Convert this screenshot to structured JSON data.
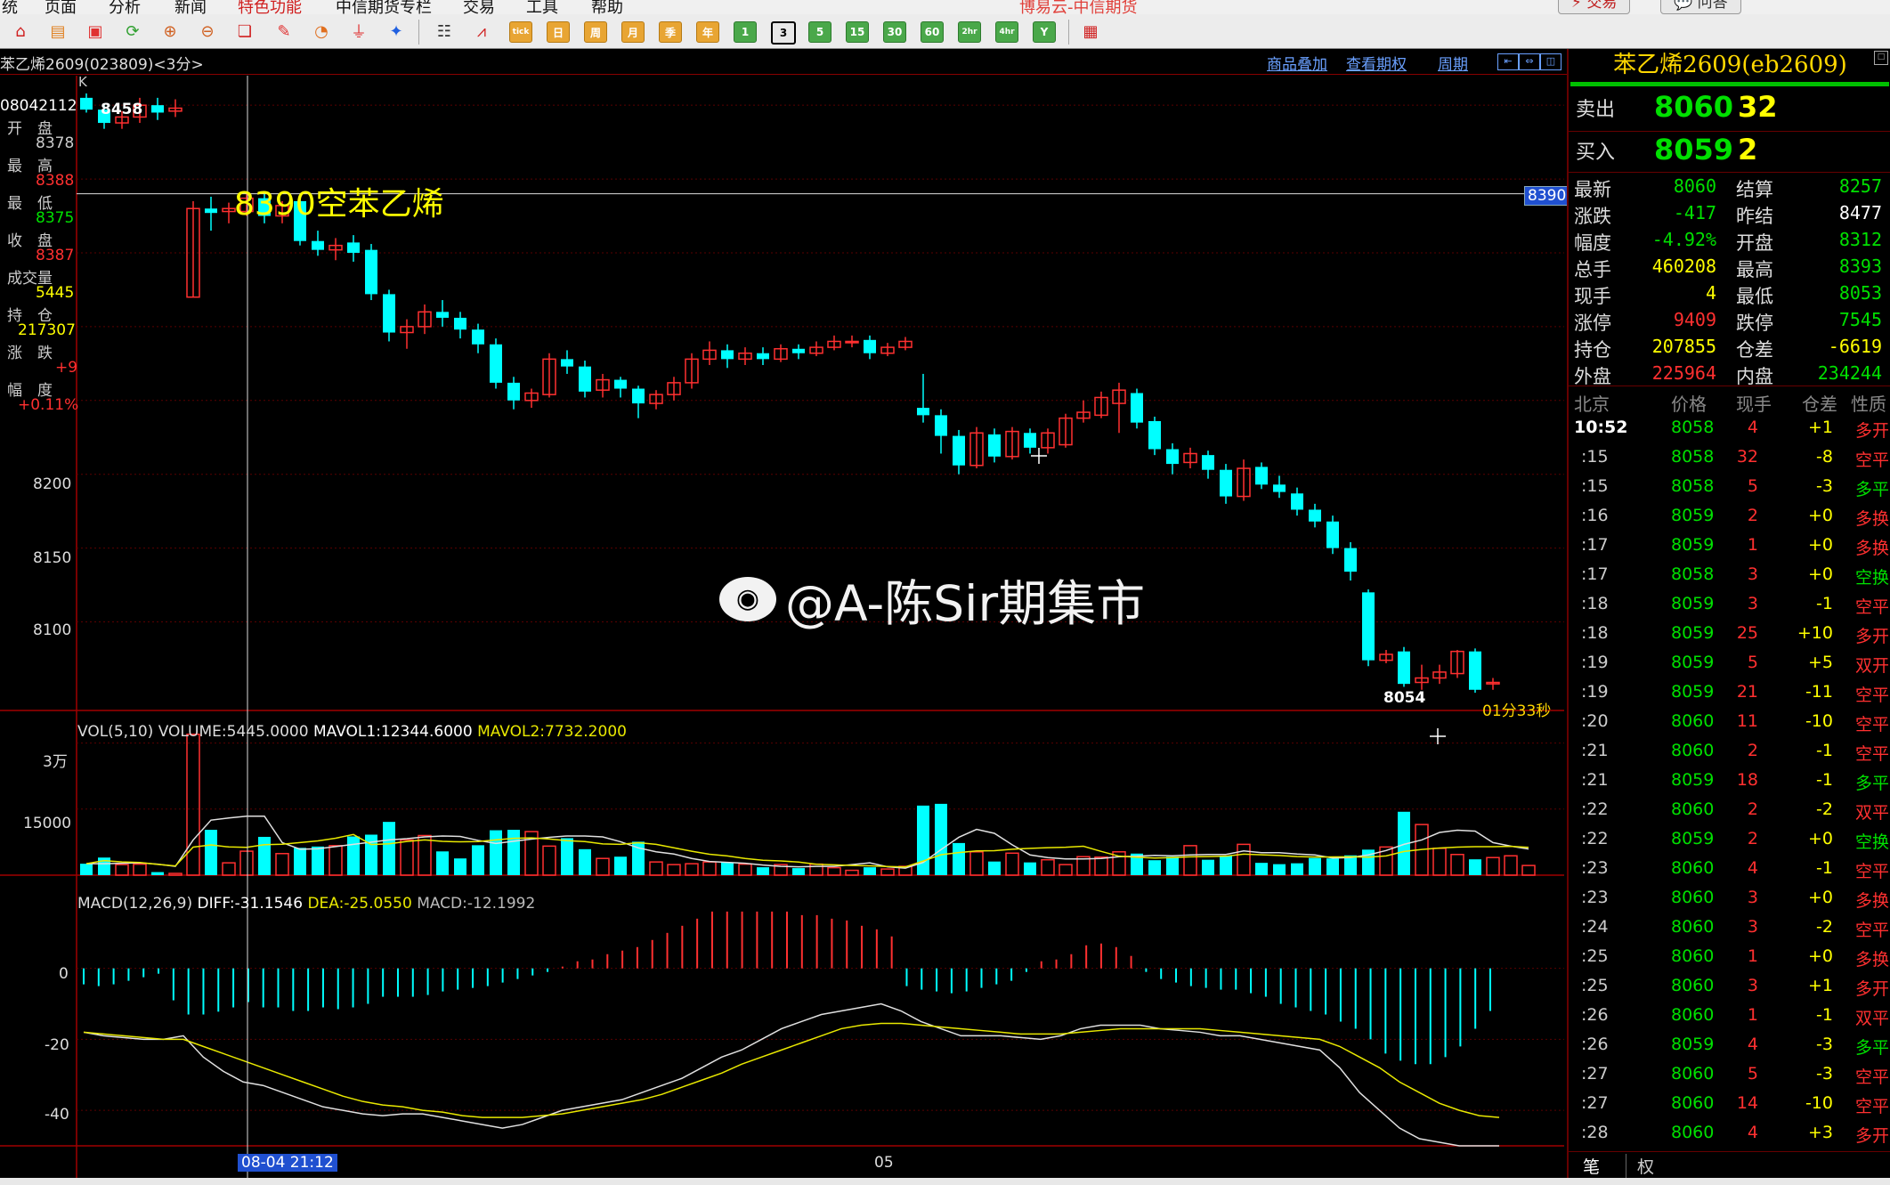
{
  "menu": {
    "items": [
      "统",
      "页面",
      "分析",
      "新闻",
      "特色功能",
      "中信期货专栏",
      "交易",
      "工具",
      "帮助"
    ],
    "window_title": "博易云-中信期货",
    "trade_button": "交易",
    "ask_button": "问答"
  },
  "toolbar": {
    "period_buttons": [
      "日",
      "周",
      "月",
      "季",
      "年"
    ],
    "minute_buttons": [
      "1",
      "3",
      "5",
      "15",
      "30",
      "60",
      "2hr",
      "4hr",
      "Y"
    ],
    "selected_period": "3"
  },
  "chart_header": {
    "symbol": "苯乙烯2609(023809)<3分>",
    "link_overlay": "商品叠加",
    "link_options": "查看期权",
    "link_period": "周期"
  },
  "info_panel": {
    "type_label": "K",
    "time": "08042112",
    "open_label": "开　盘",
    "open_value": "8378",
    "high_label": "最　高",
    "high_value": "8388",
    "low_label": "最　低",
    "low_value": "8375",
    "close_label": "收　盘",
    "close_value": "8387",
    "volume_label": "成交量",
    "volume_value": "5445",
    "oi_label": "持　仓",
    "oi_value": "217307",
    "change_label": "涨　跌",
    "change_value": "+9",
    "range_label": "幅　度",
    "range_value": "+0.11%"
  },
  "chart_data": {
    "type": "candlestick",
    "title": "苯乙烯2609(023809)<3分>",
    "ylim": [
      8040,
      8470
    ],
    "y_ticks": [
      8200,
      8150,
      8100
    ],
    "y_tick_labels": [
      "8200",
      "8150",
      "8100"
    ],
    "annotations": {
      "top_price": "8458",
      "crosshair_price": "8390",
      "crosshair_note": "8390空苯乙烯",
      "low_price": "8054",
      "countdown": "01分33秒",
      "cursor_time": "08-04 21:12",
      "date_marker": "05"
    },
    "candles": [
      [
        8455,
        8447,
        8458,
        8445
      ],
      [
        8447,
        8438,
        8450,
        8434
      ],
      [
        8438,
        8442,
        8446,
        8434
      ],
      [
        8442,
        8450,
        8455,
        8438
      ],
      [
        8450,
        8445,
        8455,
        8440
      ],
      [
        8446,
        8448,
        8454,
        8442
      ],
      [
        8320,
        8380,
        8385,
        8320
      ],
      [
        8380,
        8377,
        8388,
        8365
      ],
      [
        8378,
        8380,
        8384,
        8370
      ],
      [
        8378,
        8387,
        8390,
        8375
      ],
      [
        8387,
        8375,
        8390,
        8370
      ],
      [
        8375,
        8382,
        8385,
        8370
      ],
      [
        8385,
        8358,
        8388,
        8355
      ],
      [
        8358,
        8352,
        8365,
        8348
      ],
      [
        8352,
        8355,
        8360,
        8345
      ],
      [
        8357,
        8350,
        8362,
        8344
      ],
      [
        8352,
        8322,
        8356,
        8318
      ],
      [
        8322,
        8296,
        8325,
        8290
      ],
      [
        8296,
        8300,
        8305,
        8285
      ],
      [
        8300,
        8310,
        8315,
        8295
      ],
      [
        8310,
        8306,
        8318,
        8300
      ],
      [
        8306,
        8298,
        8310,
        8292
      ],
      [
        8298,
        8288,
        8302,
        8282
      ],
      [
        8288,
        8262,
        8292,
        8258
      ],
      [
        8262,
        8250,
        8266,
        8244
      ],
      [
        8250,
        8255,
        8258,
        8245
      ],
      [
        8254,
        8278,
        8282,
        8252
      ],
      [
        8278,
        8273,
        8284,
        8268
      ],
      [
        8273,
        8256,
        8277,
        8252
      ],
      [
        8257,
        8264,
        8268,
        8252
      ],
      [
        8264,
        8258,
        8266,
        8252
      ],
      [
        8258,
        8248,
        8260,
        8238
      ],
      [
        8248,
        8254,
        8257,
        8244
      ],
      [
        8254,
        8262,
        8266,
        8250
      ],
      [
        8262,
        8278,
        8282,
        8258
      ],
      [
        8278,
        8284,
        8290,
        8274
      ],
      [
        8284,
        8278,
        8288,
        8272
      ],
      [
        8278,
        8282,
        8286,
        8274
      ],
      [
        8282,
        8278,
        8286,
        8274
      ],
      [
        8278,
        8285,
        8288,
        8276
      ],
      [
        8285,
        8282,
        8288,
        8278
      ],
      [
        8282,
        8286,
        8290,
        8280
      ],
      [
        8286,
        8290,
        8294,
        8284
      ],
      [
        8290,
        8290,
        8294,
        8286
      ],
      [
        8291,
        8282,
        8294,
        8278
      ],
      [
        8282,
        8286,
        8289,
        8280
      ],
      [
        8286,
        8290,
        8293,
        8284
      ],
      [
        8245,
        8240,
        8268,
        8235
      ],
      [
        8240,
        8226,
        8244,
        8214
      ],
      [
        8226,
        8206,
        8230,
        8200
      ],
      [
        8206,
        8228,
        8232,
        8204
      ],
      [
        8227,
        8212,
        8231,
        8208
      ],
      [
        8212,
        8229,
        8232,
        8210
      ],
      [
        8228,
        8218,
        8231,
        8214
      ],
      [
        8218,
        8228,
        8231,
        8214
      ],
      [
        8220,
        8238,
        8241,
        8218
      ],
      [
        8238,
        8242,
        8250,
        8235
      ],
      [
        8240,
        8252,
        8256,
        8238
      ],
      [
        8248,
        8257,
        8262,
        8228
      ],
      [
        8255,
        8235,
        8258,
        8231
      ],
      [
        8236,
        8217,
        8239,
        8213
      ],
      [
        8217,
        8207,
        8221,
        8200
      ],
      [
        8208,
        8214,
        8218,
        8204
      ],
      [
        8213,
        8203,
        8216,
        8197
      ],
      [
        8203,
        8185,
        8207,
        8180
      ],
      [
        8185,
        8204,
        8210,
        8182
      ],
      [
        8205,
        8193,
        8208,
        8190
      ],
      [
        8193,
        8188,
        8199,
        8184
      ],
      [
        8187,
        8176,
        8191,
        8172
      ],
      [
        8176,
        8168,
        8180,
        8164
      ],
      [
        8168,
        8150,
        8172,
        8146
      ],
      [
        8150,
        8134,
        8154,
        8128
      ],
      [
        8120,
        8074,
        8122,
        8070
      ],
      [
        8074,
        8078,
        8081,
        8072
      ],
      [
        8080,
        8058,
        8083,
        8056
      ],
      [
        8059,
        8062,
        8071,
        8054
      ],
      [
        8062,
        8066,
        8071,
        8058
      ],
      [
        8065,
        8080,
        8081,
        8062
      ],
      [
        8080,
        8054,
        8082,
        8052
      ],
      [
        8058,
        8059,
        8062,
        8054
      ]
    ],
    "volume": {
      "label": "VOL(5,10)",
      "volume_text": "VOLUME:5445.0000",
      "mavol1_text": "MAVOL1:12344.6000",
      "mavol2_text": "MAVOL2:7732.2000",
      "ylim": [
        0,
        37000
      ],
      "y_tick_labels": [
        "3万",
        "15000"
      ],
      "y_ticks": [
        30000,
        15000
      ],
      "values": [
        2600,
        4000,
        2400,
        2500,
        700,
        400,
        32000,
        10300,
        2800,
        5445,
        8700,
        4900,
        6200,
        6500,
        6700,
        8800,
        9200,
        12100,
        8000,
        9000,
        5400,
        3800,
        6800,
        10200,
        10300,
        9900,
        6600,
        8400,
        5900,
        3800,
        4200,
        7600,
        3000,
        2400,
        2600,
        3000,
        2900,
        2500,
        1800,
        2400,
        1600,
        2500,
        1700,
        1100,
        1800,
        1400,
        2000,
        15800,
        16200,
        7300,
        5300,
        3100,
        5000,
        2900,
        3500,
        2400,
        4200,
        4100,
        5300,
        4900,
        3400,
        4200,
        6700,
        3500,
        4400,
        7000,
        2800,
        2500,
        2700,
        3900,
        3800,
        4500,
        5800,
        6400,
        14400,
        11500,
        6100,
        4700,
        3600,
        4000,
        4400,
        2200
      ],
      "mavol1": [
        2600,
        2600,
        2700,
        2800,
        2500,
        2000,
        8000,
        12500,
        13000,
        13400,
        13400,
        7400,
        5900,
        6000,
        6500,
        7000,
        7500,
        8000,
        8300,
        8700,
        8900,
        8800,
        7900,
        7200,
        7700,
        8200,
        8600,
        8900,
        8900,
        8700,
        7600,
        6200,
        5300,
        4800,
        3800,
        3100,
        2900,
        2700,
        2300,
        2000,
        1900,
        2000,
        2000,
        2400,
        2800,
        1900,
        1600,
        2900,
        5800,
        8600,
        10400,
        9500,
        6900,
        4600,
        4000,
        3700,
        3700,
        3800,
        4200,
        4300,
        4500,
        4400,
        4600,
        4700,
        4700,
        5500,
        5100,
        5100,
        4800,
        4600,
        3900,
        4000,
        4600,
        5600,
        7000,
        8000,
        9700,
        10200,
        10000,
        7400,
        6600,
        5945
      ]
    },
    "macd": {
      "label": "MACD(12,26,9)",
      "diff_text": "DIFF:-31.1546",
      "dea_text": "DEA:-25.0550",
      "macd_text": "MACD:-12.1992",
      "ylim": [
        -50,
        24
      ],
      "y_ticks": [
        0,
        -20,
        -40
      ],
      "y_tick_labels": [
        "0",
        "-20",
        "-40"
      ],
      "bars": [
        -4.5,
        -5,
        -4.5,
        -3.5,
        -2.5,
        -1.5,
        -9,
        -13,
        -13,
        -12.2,
        -11,
        -9.5,
        -11,
        -11,
        -12,
        -12,
        -11,
        -11.5,
        -11,
        -10,
        -8,
        -8,
        -8,
        -7.5,
        -6.5,
        -6,
        -5.5,
        -5,
        -4,
        -3,
        -2,
        -1,
        0.5,
        2,
        2.5,
        4,
        5,
        6,
        8,
        10,
        12,
        14,
        16,
        16,
        16,
        16,
        16,
        16,
        15,
        15,
        14,
        13.5,
        12,
        11,
        9,
        -5,
        -6,
        -6.5,
        -7,
        -6.5,
        -5.5,
        -4.5,
        -3.5,
        -1,
        2,
        2.5,
        4,
        6.5,
        7,
        6,
        3.5,
        -1,
        -3,
        -4,
        -5,
        -5.5,
        -6,
        -6,
        -7,
        -8,
        -10,
        -11,
        -12,
        -13,
        -15,
        -17,
        -20,
        -24,
        -26,
        -27,
        -27,
        -25,
        -22,
        -17,
        -12
      ],
      "diff": [
        -18,
        -19,
        -19.5,
        -20,
        -20,
        -19,
        -25,
        -29,
        -32,
        -33,
        -35,
        -37,
        -39,
        -40,
        -41,
        -41.5,
        -41,
        -41,
        -42,
        -43,
        -44,
        -45,
        -44,
        -42,
        -40,
        -39,
        -38,
        -37,
        -35,
        -33,
        -31,
        -28,
        -25,
        -23,
        -20,
        -17,
        -15,
        -13,
        -12,
        -11,
        -10,
        -12,
        -15,
        -17,
        -19,
        -19,
        -19,
        -19.5,
        -20,
        -19,
        -17,
        -16,
        -16,
        -16,
        -17,
        -17.5,
        -18,
        -19,
        -19,
        -20,
        -21,
        -22,
        -23,
        -28,
        -35,
        -40,
        -45,
        -48,
        -49,
        -50,
        -50,
        -50
      ],
      "dea": [
        -18,
        -18.5,
        -19,
        -19.5,
        -20,
        -20,
        -22,
        -24,
        -26,
        -28,
        -30,
        -32,
        -34,
        -36,
        -37.5,
        -38.5,
        -39,
        -40,
        -40.5,
        -41.5,
        -42,
        -42,
        -42,
        -41.5,
        -41,
        -40,
        -39,
        -38,
        -37,
        -35.5,
        -33.5,
        -31.5,
        -29.5,
        -27,
        -25,
        -23,
        -21,
        -19,
        -17,
        -16,
        -15.5,
        -15.5,
        -16,
        -16.5,
        -17,
        -17.5,
        -18,
        -18.5,
        -18.5,
        -18.5,
        -18,
        -17.5,
        -17,
        -17,
        -17,
        -17,
        -17,
        -17.5,
        -18,
        -18.5,
        -19,
        -19.5,
        -20,
        -22,
        -25,
        -28,
        -32,
        -35,
        -38,
        -40,
        -41.5,
        -42
      ]
    }
  },
  "right_panel": {
    "title": "苯乙烯2609(eb2609)",
    "sell_label": "卖出",
    "sell_price": "8060",
    "sell_vol": "32",
    "buy_label": "买入",
    "buy_price": "8059",
    "buy_vol": "2",
    "quotes": [
      {
        "l1": "最新",
        "v1": "8060",
        "c1": "#00e000",
        "l2": "结算",
        "v2": "8257",
        "c2": "#00e000"
      },
      {
        "l1": "涨跌",
        "v1": "-417",
        "c1": "#00e000",
        "l2": "昨结",
        "v2": "8477",
        "c2": "#ffffff"
      },
      {
        "l1": "幅度",
        "v1": "-4.92%",
        "c1": "#00e000",
        "l2": "开盘",
        "v2": "8312",
        "c2": "#00e000"
      },
      {
        "l1": "总手",
        "v1": "460208",
        "c1": "#ffff00",
        "l2": "最高",
        "v2": "8393",
        "c2": "#00e000"
      },
      {
        "l1": "现手",
        "v1": "4",
        "c1": "#ffff00",
        "l2": "最低",
        "v2": "8053",
        "c2": "#00e000"
      },
      {
        "l1": "涨停",
        "v1": "9409",
        "c1": "#ff3030",
        "l2": "跌停",
        "v2": "7545",
        "c2": "#00e000"
      },
      {
        "l1": "持仓",
        "v1": "207855",
        "c1": "#ffff00",
        "l2": "仓差",
        "v2": "-6619",
        "c2": "#ffff00"
      },
      {
        "l1": "外盘",
        "v1": "225964",
        "c1": "#ff3030",
        "l2": "内盘",
        "v2": "234244",
        "c2": "#00e000"
      }
    ],
    "tick_headers": [
      "北京",
      "价格",
      "现手",
      "仓差",
      "性质"
    ],
    "ticks": [
      {
        "t": "10:52",
        "p": "8058",
        "v": "4",
        "d": "+1",
        "n": "多开",
        "pc": "#00e000",
        "nc": "#ff3030"
      },
      {
        "t": ":15",
        "p": "8058",
        "v": "32",
        "d": "-8",
        "n": "空平",
        "pc": "#00e000",
        "nc": "#ff3030"
      },
      {
        "t": ":15",
        "p": "8058",
        "v": "5",
        "d": "-3",
        "n": "多平",
        "pc": "#00e000",
        "nc": "#00e000"
      },
      {
        "t": ":16",
        "p": "8059",
        "v": "2",
        "d": "+0",
        "n": "多换",
        "pc": "#00e000",
        "nc": "#ff3030"
      },
      {
        "t": ":17",
        "p": "8059",
        "v": "1",
        "d": "+0",
        "n": "多换",
        "pc": "#00e000",
        "nc": "#ff3030"
      },
      {
        "t": ":17",
        "p": "8058",
        "v": "3",
        "d": "+0",
        "n": "空换",
        "pc": "#00e000",
        "nc": "#00e000"
      },
      {
        "t": ":18",
        "p": "8059",
        "v": "3",
        "d": "-1",
        "n": "空平",
        "pc": "#00e000",
        "nc": "#ff3030"
      },
      {
        "t": ":18",
        "p": "8059",
        "v": "25",
        "d": "+10",
        "n": "多开",
        "pc": "#00e000",
        "nc": "#ff3030"
      },
      {
        "t": ":19",
        "p": "8059",
        "v": "5",
        "d": "+5",
        "n": "双开",
        "pc": "#00e000",
        "nc": "#ff3030"
      },
      {
        "t": ":19",
        "p": "8059",
        "v": "21",
        "d": "-11",
        "n": "空平",
        "pc": "#00e000",
        "nc": "#ff3030"
      },
      {
        "t": ":20",
        "p": "8060",
        "v": "11",
        "d": "-10",
        "n": "空平",
        "pc": "#00e000",
        "nc": "#ff3030"
      },
      {
        "t": ":21",
        "p": "8060",
        "v": "2",
        "d": "-1",
        "n": "空平",
        "pc": "#00e000",
        "nc": "#ff3030"
      },
      {
        "t": ":21",
        "p": "8059",
        "v": "18",
        "d": "-1",
        "n": "多平",
        "pc": "#00e000",
        "nc": "#00e000"
      },
      {
        "t": ":22",
        "p": "8060",
        "v": "2",
        "d": "-2",
        "n": "双平",
        "pc": "#00e000",
        "nc": "#ff3030"
      },
      {
        "t": ":22",
        "p": "8059",
        "v": "2",
        "d": "+0",
        "n": "空换",
        "pc": "#00e000",
        "nc": "#00e000"
      },
      {
        "t": ":23",
        "p": "8060",
        "v": "4",
        "d": "-1",
        "n": "空平",
        "pc": "#00e000",
        "nc": "#ff3030"
      },
      {
        "t": ":23",
        "p": "8060",
        "v": "3",
        "d": "+0",
        "n": "多换",
        "pc": "#00e000",
        "nc": "#ff3030"
      },
      {
        "t": ":24",
        "p": "8060",
        "v": "3",
        "d": "-2",
        "n": "空平",
        "pc": "#00e000",
        "nc": "#ff3030"
      },
      {
        "t": ":25",
        "p": "8060",
        "v": "1",
        "d": "+0",
        "n": "多换",
        "pc": "#00e000",
        "nc": "#ff3030"
      },
      {
        "t": ":25",
        "p": "8060",
        "v": "3",
        "d": "+1",
        "n": "多开",
        "pc": "#00e000",
        "nc": "#ff3030"
      },
      {
        "t": ":26",
        "p": "8060",
        "v": "1",
        "d": "-1",
        "n": "双平",
        "pc": "#00e000",
        "nc": "#ff3030"
      },
      {
        "t": ":26",
        "p": "8059",
        "v": "4",
        "d": "-3",
        "n": "多平",
        "pc": "#00e000",
        "nc": "#00e000"
      },
      {
        "t": ":27",
        "p": "8060",
        "v": "5",
        "d": "-3",
        "n": "空平",
        "pc": "#00e000",
        "nc": "#ff3030"
      },
      {
        "t": ":27",
        "p": "8060",
        "v": "14",
        "d": "-10",
        "n": "空平",
        "pc": "#00e000",
        "nc": "#ff3030"
      },
      {
        "t": ":28",
        "p": "8060",
        "v": "4",
        "d": "+3",
        "n": "多开",
        "pc": "#00e000",
        "nc": "#ff3030"
      }
    ],
    "tab_trades": "笔",
    "tab_rights": "权"
  },
  "watermark": "@A-陈Sir期集市",
  "colors": {
    "up": "#ff3030",
    "down": "#00ffff",
    "grid": "#5a0000",
    "ma1": "#e0e0e0",
    "ma2": "#e8e800"
  }
}
